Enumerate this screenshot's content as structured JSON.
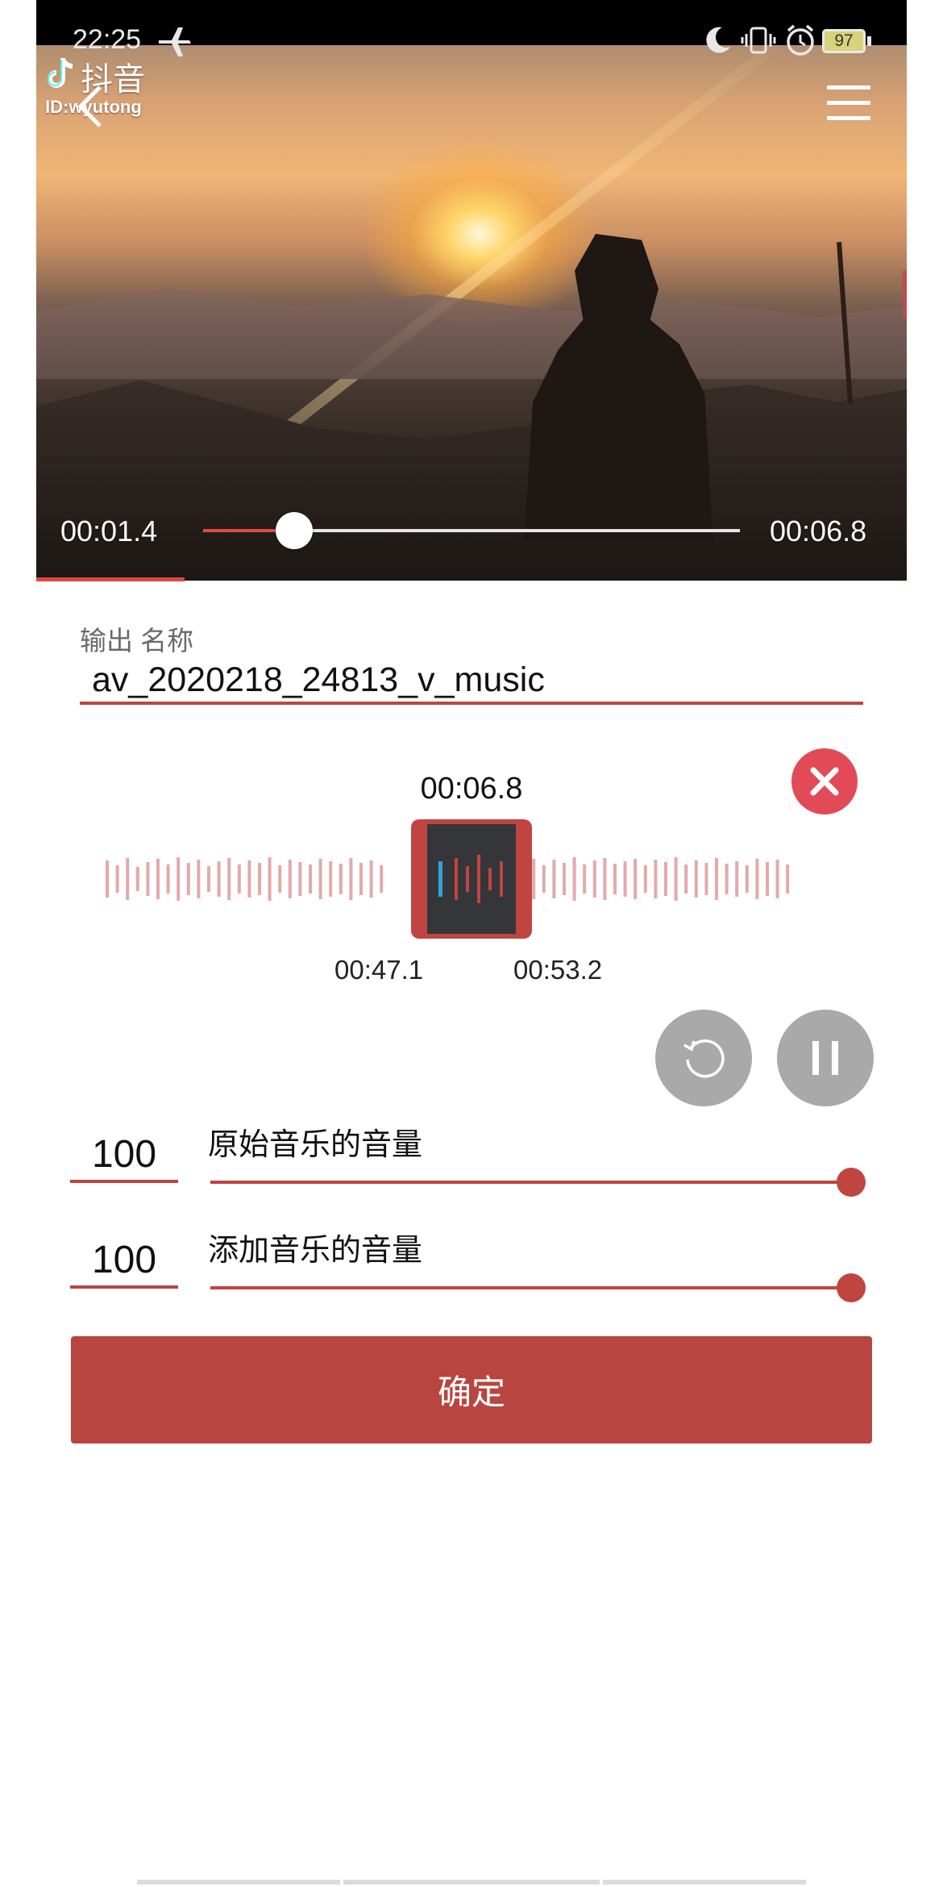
{
  "status_bar": {
    "time": "22:25",
    "battery": "97"
  },
  "watermark": {
    "app": "抖音",
    "id": "ID:wyutong"
  },
  "video": {
    "current_time": "00:01.4",
    "total_time": "00:06.8",
    "seek_progress": 0.17,
    "export_progress": 0.17
  },
  "output": {
    "label": "输出 名称",
    "value": "av_2020218_24813_v_music"
  },
  "waveform": {
    "selection_duration": "00:06.8",
    "selection_start": "00:47.1",
    "selection_end": "00:53.2"
  },
  "volume": {
    "original": {
      "value": "100",
      "label": "原始音乐的音量",
      "level": 1.0
    },
    "added": {
      "value": "100",
      "label": "添加音乐的音量",
      "level": 1.0
    }
  },
  "confirm_label": "确定",
  "colors": {
    "accent": "#c04440",
    "close": "#e24a57",
    "selection_marker": "#3a9fd6",
    "button_gray": "#a9a9a9"
  }
}
